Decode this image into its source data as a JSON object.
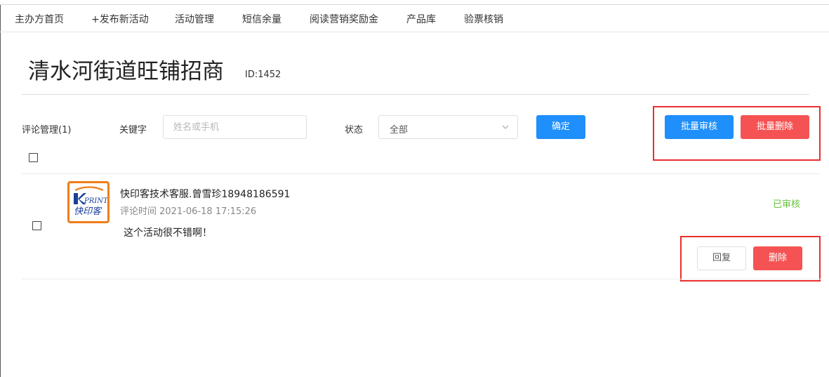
{
  "nav": {
    "items": [
      {
        "label": "主办方首页"
      },
      {
        "label": "+发布新活动"
      },
      {
        "label": "活动管理"
      },
      {
        "label": "短信余量"
      },
      {
        "label": "阅读营销奖励金"
      },
      {
        "label": "产品库"
      },
      {
        "label": "验票核销"
      }
    ]
  },
  "event": {
    "title": "清水河街道旺铺招商",
    "id_text": "ID:1452"
  },
  "filters": {
    "section_label": "评论管理(1)",
    "keyword_label": "关键字",
    "keyword_placeholder": "姓名或手机",
    "keyword_value": "",
    "status_label": "状态",
    "status_value": "全部",
    "confirm_label": "确定"
  },
  "bulk": {
    "approve_label": "批量审核",
    "delete_label": "批量删除"
  },
  "comments": [
    {
      "avatar_text": "快印客",
      "avatar_brand": "PRINT",
      "name": "快印客技术客服.曾雪珍18948186591",
      "time": "评论时间 2021-06-18 17:15:26",
      "text": "这个活动很不错啊！",
      "status": "已审核",
      "reply_label": "回复",
      "delete_label": "删除"
    }
  ],
  "colors": {
    "primary": "#1e8ffb",
    "danger": "#f55353",
    "success": "#67c23a",
    "highlight": "#e8302e",
    "logo_orange": "#f07d1a",
    "logo_blue": "#1a3f9c"
  }
}
